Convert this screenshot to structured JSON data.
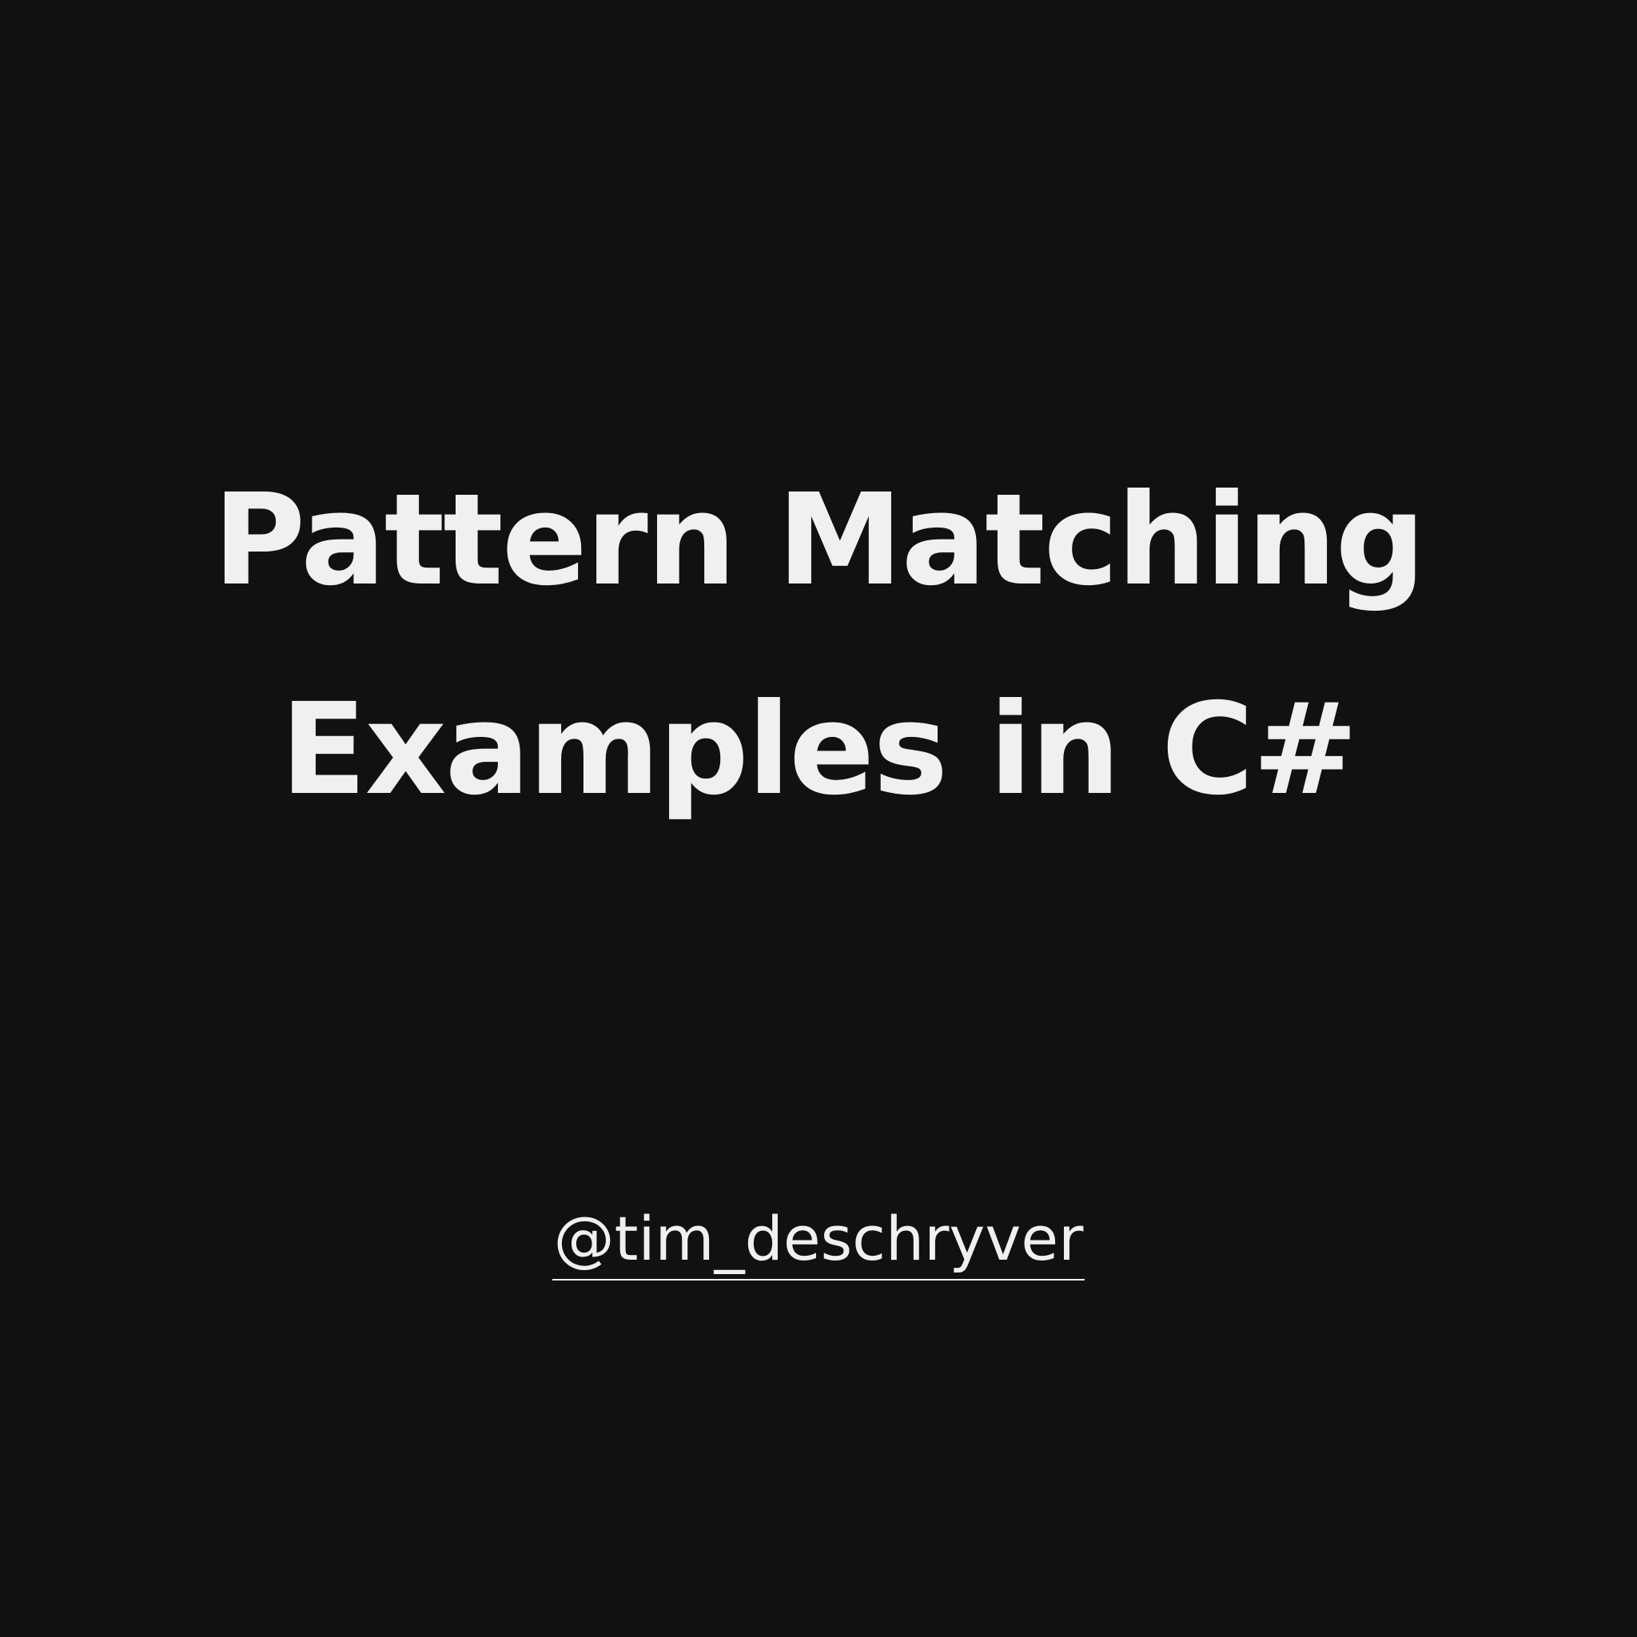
{
  "title": {
    "line1": "Pattern Matching",
    "line2": "Examples in C#"
  },
  "author": {
    "handle": "@tim_deschryver"
  },
  "colors": {
    "background": "#111111",
    "text": "#f0f0f0"
  }
}
